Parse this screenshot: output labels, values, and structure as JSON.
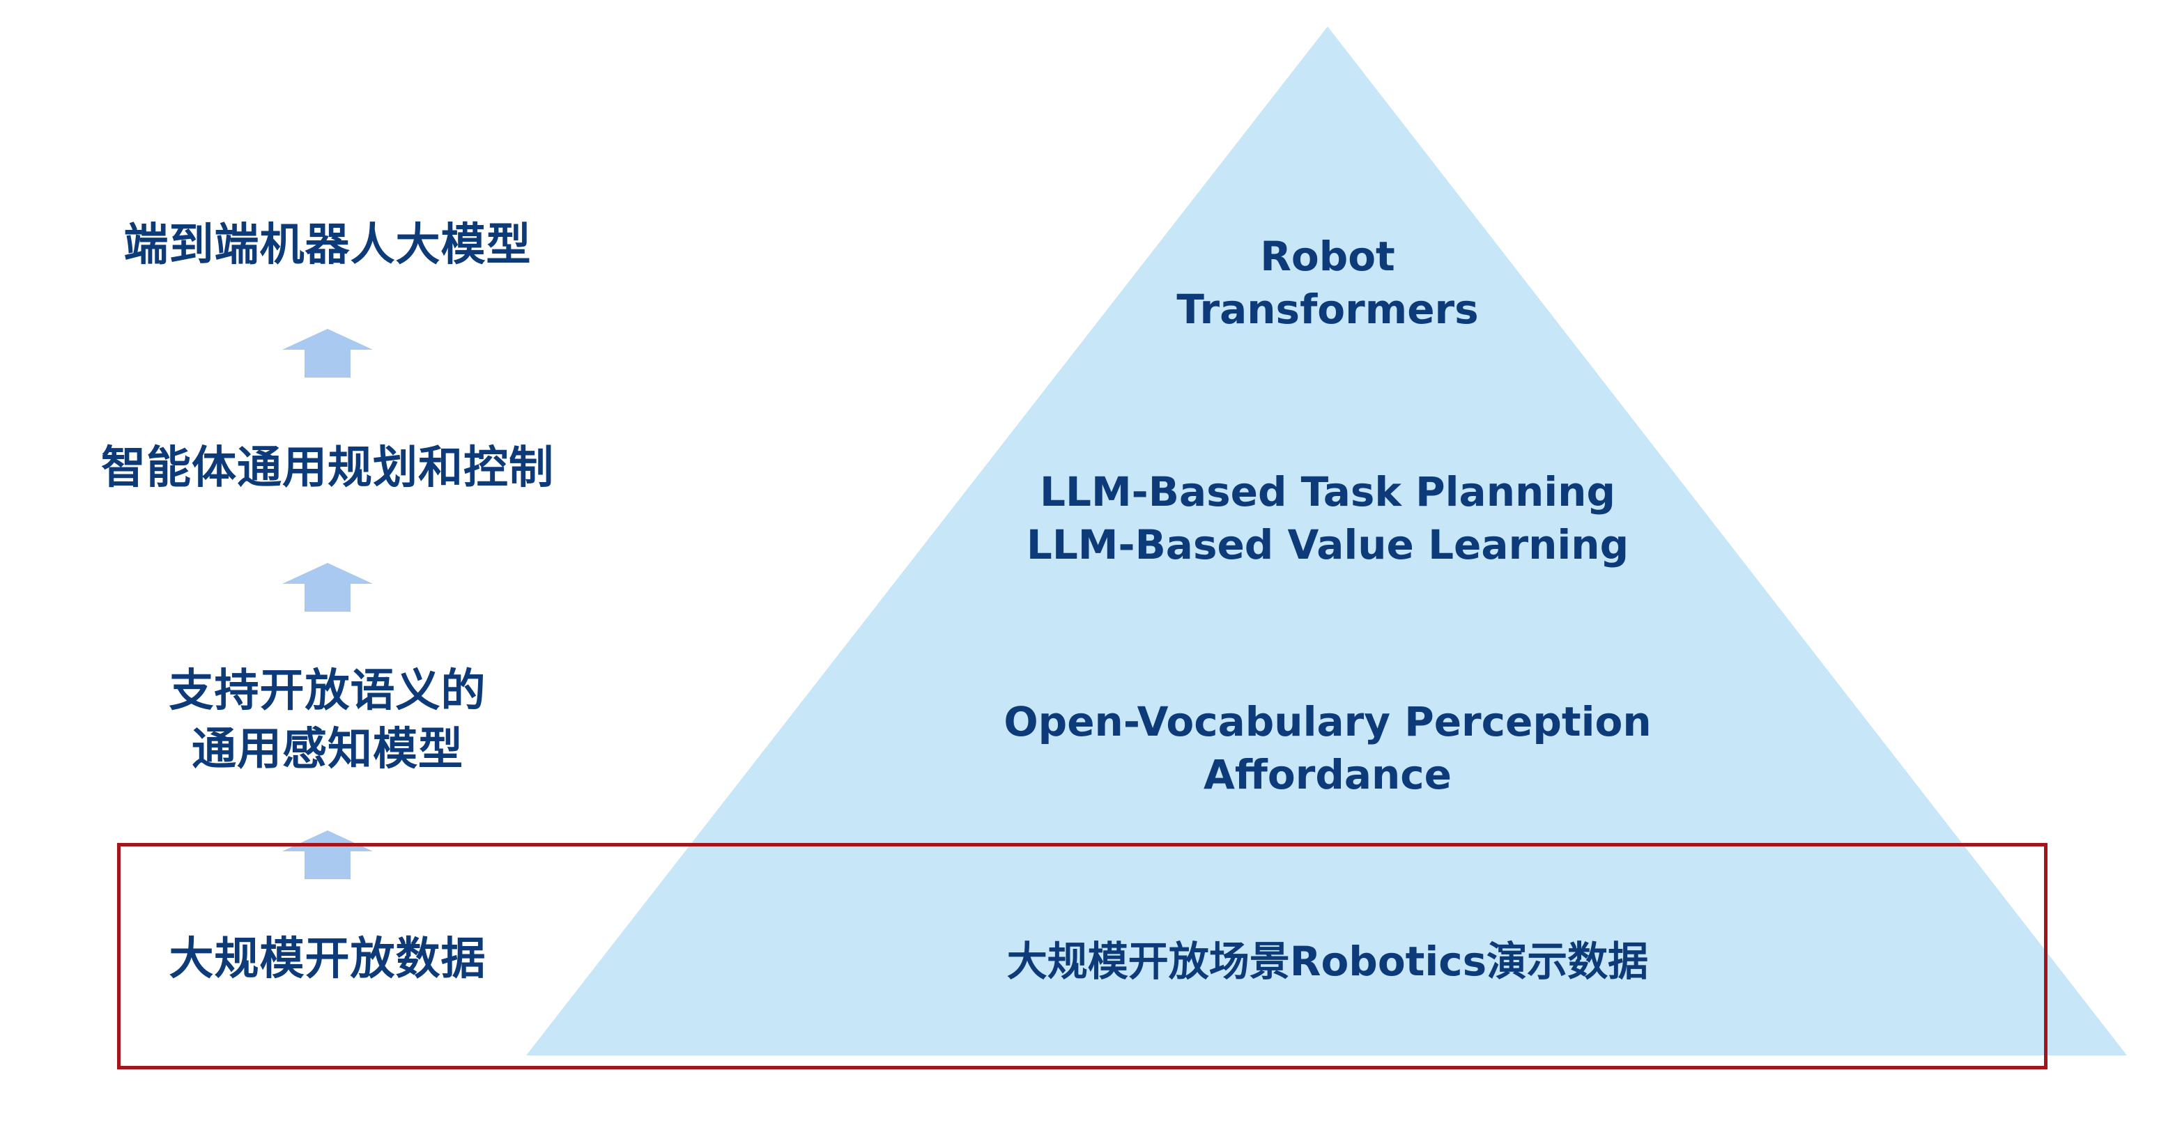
{
  "left_labels": {
    "top": "端到端机器人大模型",
    "upper": "智能体通用规划和控制",
    "middle": [
      "支持开放语义的",
      "通用感知模型"
    ],
    "bottom": "大规模开放数据"
  },
  "pyramid_tiers": {
    "top": [
      "Robot",
      "Transformers"
    ],
    "upper": [
      "LLM-Based Task Planning",
      "LLM-Based Value Learning"
    ],
    "middle": [
      "Open-Vocabulary Perception",
      "Affordance"
    ],
    "bottom": "大规模开放场景Robotics演示数据"
  },
  "colors": {
    "pyramid_fill": "#c7e6f8",
    "text": "#0d3a78",
    "arrow": "#a9c9f1",
    "highlight_border": "#a3141b"
  }
}
